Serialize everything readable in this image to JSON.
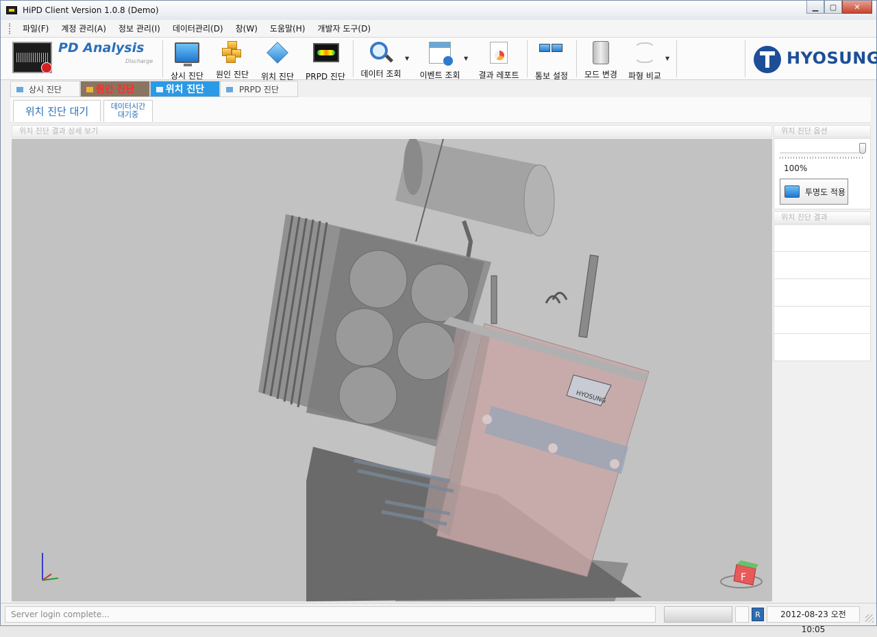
{
  "window": {
    "title": "HiPD Client Version 1.0.8 (Demo)",
    "min_label": "▁",
    "max_label": "▢",
    "close_label": "✕"
  },
  "menu": [
    "파일(F)",
    "계정 관리(A)",
    "정보 관리(I)",
    "데이터관리(D)",
    "창(W)",
    "도움말(H)",
    "개발자 도구(D)"
  ],
  "brand": {
    "title": "PD Analysis",
    "subtitle": "Discharge",
    "company": "HYOSUNG"
  },
  "toolbar": {
    "normal": "상시 진단",
    "cause": "원인 진단",
    "location": "위치 진단",
    "prpd": "PRPD 진단",
    "data_query": "데이터 조회",
    "event_query": "이벤트 조회",
    "report": "결과 레포트",
    "comm": "통보 설정",
    "mode": "모드 변경",
    "wave": "파형 비교"
  },
  "tabs": [
    "상시 진단",
    "원인 진단",
    "위치 진단",
    "PRPD 진단"
  ],
  "active_tab": "위치 진단",
  "subtabs": {
    "active": "위치 진단 대기",
    "other_line1": "데이터시간",
    "other_line2": "대기중"
  },
  "view": {
    "header": "위치 진단 결과 상세 보기",
    "marker_label": "HYOSUNG",
    "cube_label": "F"
  },
  "options": {
    "header": "위치 진단 옵션",
    "transparency_value": 1.0,
    "transparency_text": "100%",
    "apply_label": "투명도 적용"
  },
  "results": {
    "header": "위치 진단 결과",
    "rows": [
      "",
      "",
      "",
      "",
      ""
    ]
  },
  "status": {
    "message": "Server login complete...",
    "indicator": "R",
    "datetime": "2012-08-23 오전 10:05"
  },
  "colors": {
    "accent": "#2b9ae6",
    "brand": "#1d4e97",
    "cause_tab_text": "#ff2a2a"
  }
}
